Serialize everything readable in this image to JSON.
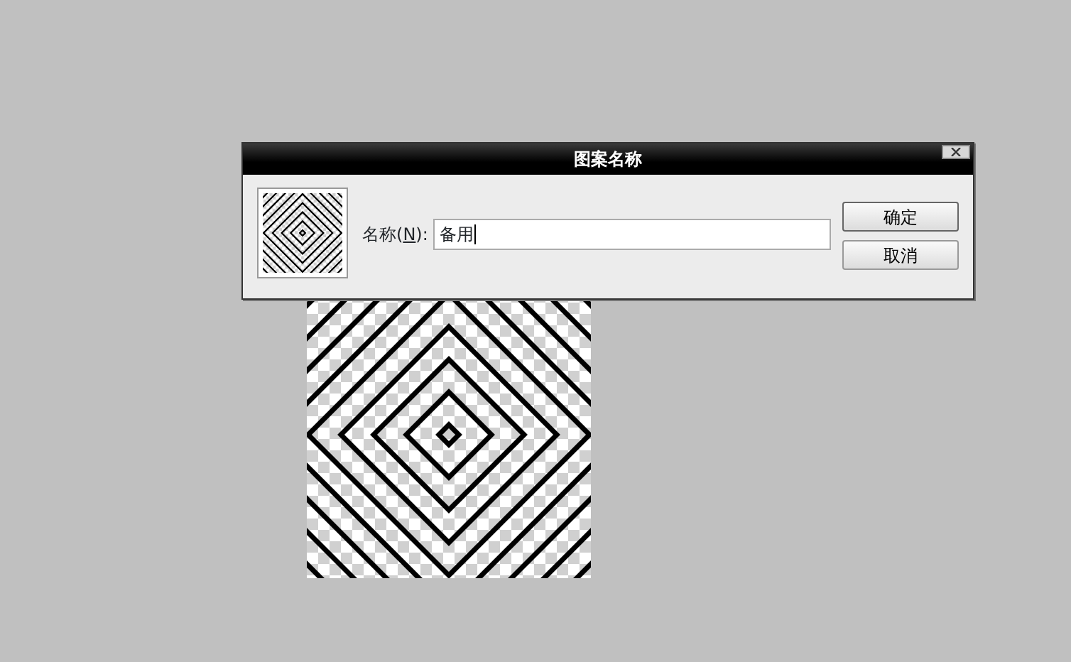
{
  "dialog": {
    "title": "图案名称",
    "name_field": {
      "label_before": "名称(",
      "mnemonic": "N",
      "label_after": "):",
      "value": "备用",
      "focused": true
    },
    "buttons": [
      {
        "label": "确定",
        "default": true
      },
      {
        "label": "取消",
        "default": false
      }
    ]
  }
}
